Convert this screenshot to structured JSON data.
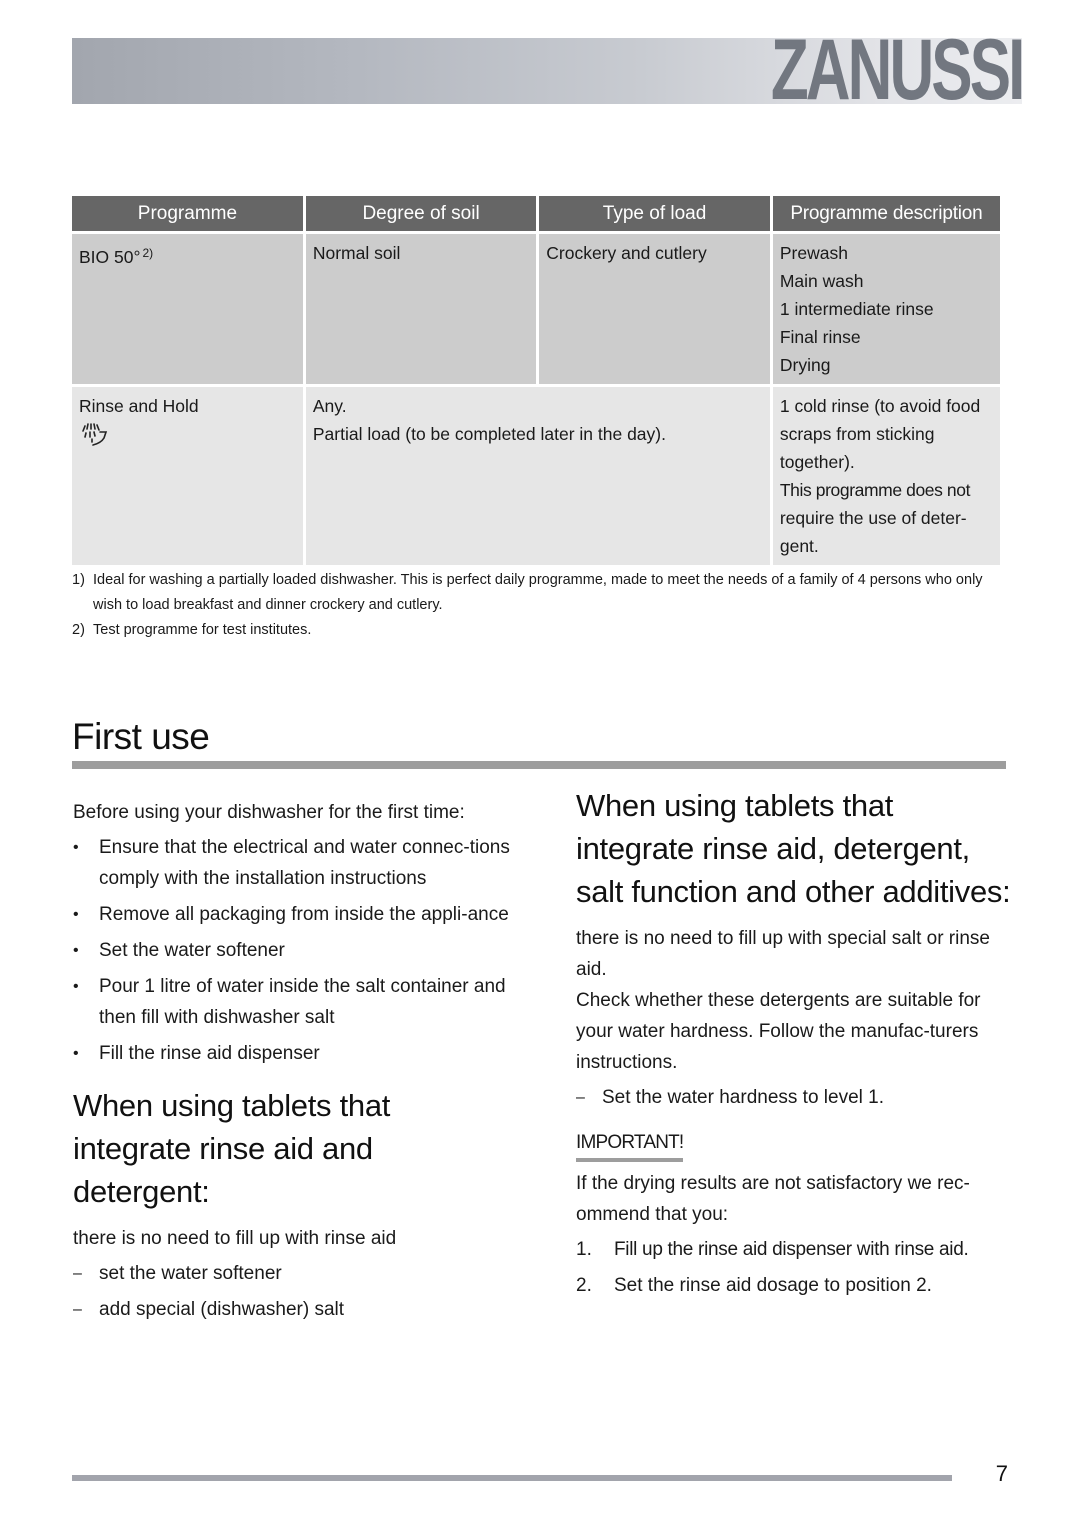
{
  "header": {
    "brand": "ZANUSSI",
    "brand_color": "#727780"
  },
  "table": {
    "columns": [
      "Programme",
      "Degree of soil",
      "Type of load",
      "Programme description"
    ],
    "rows": [
      {
        "programme": "BIO 50°",
        "programme_footnote": "2)",
        "soil": "Normal soil",
        "load": "Crockery and cutlery",
        "description": [
          "Prewash",
          "Main wash",
          "1 intermediate rinse",
          "Final rinse",
          "Drying"
        ]
      },
      {
        "programme": "Rinse and Hold",
        "programme_icon": "rinse-and-hold-icon",
        "soil": "Any.",
        "load": "Partial load (to be completed later in the day).",
        "description": [
          "1 cold rinse (to avoid food",
          "scraps from sticking",
          "together).",
          "This programme does not",
          "require the use of deter-",
          "gent."
        ]
      }
    ],
    "footnotes": [
      {
        "num": "1)",
        "text": "Ideal for washing a partially loaded dishwasher. This is perfect daily programme, made to meet the needs of a family of 4 persons who only wish to load breakfast and dinner crockery and cutlery."
      },
      {
        "num": "2)",
        "text": "Test programme for test institutes."
      }
    ]
  },
  "section": {
    "title": "First use",
    "left": {
      "intro": "Before using your dishwasher for the first time:",
      "bullets": [
        "Ensure that the electrical and water connec-tions comply with the installation instructions",
        "Remove all packaging from inside the appli-ance",
        "Set the water softener",
        "Pour 1 litre of water inside the salt container and then fill with dishwasher salt",
        "Fill the rinse aid dispenser"
      ],
      "subheading": "When using tablets that integrate rinse aid and detergent:",
      "sub_intro": "there is no need to fill up with rinse aid",
      "dash_items": [
        "set the water softener",
        "add special (dishwasher) salt"
      ]
    },
    "right": {
      "subheading": "When using tablets that integrate rinse aid, detergent, salt function and other additives:",
      "para1": "there is no need to fill up with special salt or rinse aid.",
      "para2": "Check whether these detergents are suitable for your water hardness. Follow the manufac-turers instructions.",
      "dash_items": [
        "Set the water hardness to level 1."
      ],
      "important_label": "IMPORTANT!",
      "important_text": "If the drying results are not satisfactory we rec-ommend that you:",
      "steps": [
        {
          "num": "1.",
          "text": "Fill up the rinse aid dispenser with rinse aid."
        },
        {
          "num": "2.",
          "text": "Set the rinse aid dosage to position 2."
        }
      ]
    }
  },
  "footer": {
    "page_number": "7"
  },
  "symbols": {
    "bullet": "•",
    "dash": "–"
  }
}
